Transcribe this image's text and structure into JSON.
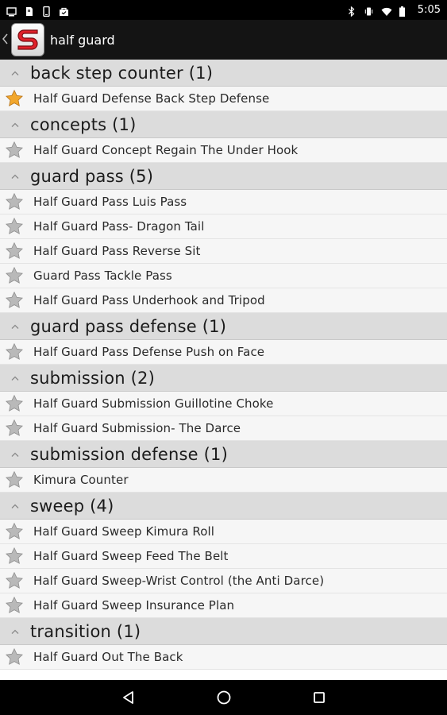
{
  "status_bar": {
    "time": "5:05",
    "left_icons": [
      "screenshot-icon",
      "sd-card-icon",
      "phone-icon",
      "bag-icon"
    ],
    "right_icons": [
      "bluetooth-icon",
      "vibrate-icon",
      "wifi-icon",
      "battery-icon"
    ]
  },
  "action_bar": {
    "title": "half guard",
    "logo_icon": "stylized-s-logo-icon",
    "brand_color": "#e0202a"
  },
  "colors": {
    "star_favorite": "#f2a72c",
    "star_default": "#b9b9b9",
    "section_bg": "#dcdcdc",
    "item_bg": "#f6f6f6"
  },
  "sections": [
    {
      "title": "back step counter (1)",
      "items": [
        {
          "label": "Half Guard Defense Back Step Defense",
          "favorite": true
        }
      ]
    },
    {
      "title": "concepts (1)",
      "items": [
        {
          "label": "Half Guard Concept Regain The Under Hook",
          "favorite": false
        }
      ]
    },
    {
      "title": "guard pass (5)",
      "items": [
        {
          "label": "Half Guard Pass Luis Pass",
          "favorite": false
        },
        {
          "label": "Half Guard Pass- Dragon Tail",
          "favorite": false
        },
        {
          "label": "Half Guard Pass Reverse Sit",
          "favorite": false
        },
        {
          "label": "Guard Pass Tackle Pass",
          "favorite": false
        },
        {
          "label": "Half Guard Pass Underhook and Tripod",
          "favorite": false
        }
      ]
    },
    {
      "title": "guard pass defense (1)",
      "items": [
        {
          "label": "Half Guard Pass Defense Push on Face",
          "favorite": false
        }
      ]
    },
    {
      "title": "submission (2)",
      "items": [
        {
          "label": "Half Guard Submission Guillotine Choke",
          "favorite": false
        },
        {
          "label": "Half Guard Submission- The Darce",
          "favorite": false
        }
      ]
    },
    {
      "title": "submission defense (1)",
      "items": [
        {
          "label": "Kimura Counter",
          "favorite": false
        }
      ]
    },
    {
      "title": "sweep (4)",
      "items": [
        {
          "label": "Half Guard Sweep Kimura Roll",
          "favorite": false
        },
        {
          "label": "Half Guard Sweep Feed The Belt",
          "favorite": false
        },
        {
          "label": "Half Guard Sweep-Wrist Control (the Anti Darce)",
          "favorite": false
        },
        {
          "label": "Half Guard Sweep Insurance Plan",
          "favorite": false
        }
      ]
    },
    {
      "title": "transition (1)",
      "items": [
        {
          "label": "Half Guard Out The Back",
          "favorite": false
        }
      ]
    }
  ],
  "nav_bar": {
    "buttons": [
      "back-triangle-icon",
      "home-circle-icon",
      "recents-square-icon"
    ]
  }
}
